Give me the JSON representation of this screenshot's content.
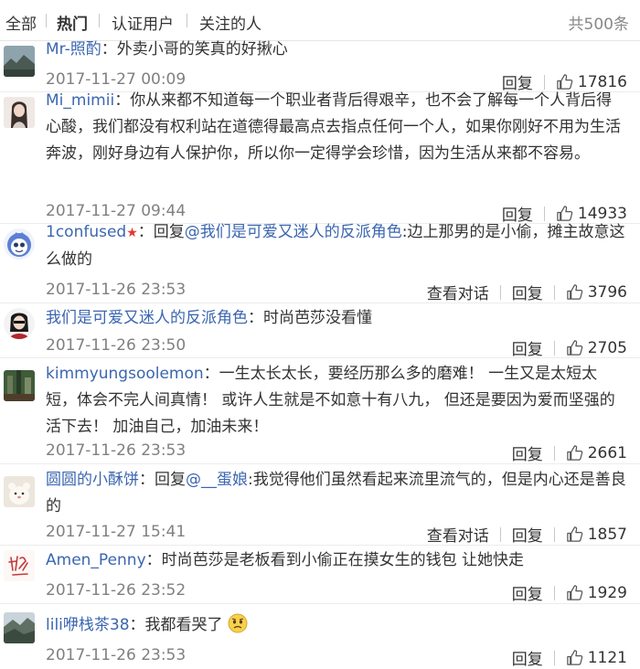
{
  "tabs": {
    "all": "全部",
    "hot": "热门",
    "verified": "认证用户",
    "following": "关注的人",
    "total": "共500条"
  },
  "actions": {
    "reply": "回复",
    "view_conversation": "查看对话"
  },
  "comments": [
    {
      "user": "Mr-照酌",
      "sep": "：",
      "text": "外卖小哥的笑真的好揪心",
      "time": "2017-11-27 00:09",
      "likes": "17816"
    },
    {
      "user": "Mi_mimii",
      "sep": "：",
      "text": "你从来都不知道每一个职业者背后得艰辛，也不会了解每一个人背后得心酸，我们都没有权利站在道德得最高点去指点任何一个人，如果你刚好不用为生活奔波，刚好身边有人保护你，所以你一定得学会珍惜，因为生活从来都不容易。",
      "time": "2017-11-27 09:44",
      "likes": "14933"
    },
    {
      "user": "1confused",
      "sep": "：",
      "reply_prefix": "回复",
      "mention": "@我们是可爱又迷人的反派角色",
      "text": ":边上那男的是小偷，摊主故意这么做的",
      "time": "2017-11-26 23:53",
      "likes": "3796"
    },
    {
      "user": "我们是可爱又迷人的反派角色",
      "sep": "：",
      "text": "时尚芭莎没看懂",
      "time": "2017-11-26 23:50",
      "likes": "2705"
    },
    {
      "user": "kimmyungsoolemon",
      "sep": "：",
      "text": "一生太长太长，要经历那么多的磨难！ 一生又是太短太短，体会不完人间真情！ 或许人生就是不如意十有八九， 但还是要因为爱而坚强的活下去！ 加油自己，加油未来！",
      "time": "2017-11-26 23:53",
      "likes": "2661"
    },
    {
      "user": "圆圆的小酥饼",
      "sep": "：",
      "reply_prefix": "回复",
      "mention": "@__蛋娘",
      "text": ":我觉得他们虽然看起来流里流气的，但是内心还是善良的",
      "time": "2017-11-27 15:41",
      "likes": "1857"
    },
    {
      "user": "Amen_Penny",
      "sep": "：",
      "text": "时尚芭莎是老板看到小偷正在摸女生的钱包 让她快走",
      "time": "2017-11-26 23:52",
      "likes": "1929"
    },
    {
      "user": "lili咿栈茶38",
      "sep": "：",
      "text": "我都看哭了",
      "time": "2017-11-26 23:53",
      "likes": "1121"
    }
  ],
  "icons": {
    "like": "thumbs-up-icon",
    "verified_star": "red-star-icon",
    "emoji": "sad-face-emoji-icon"
  }
}
